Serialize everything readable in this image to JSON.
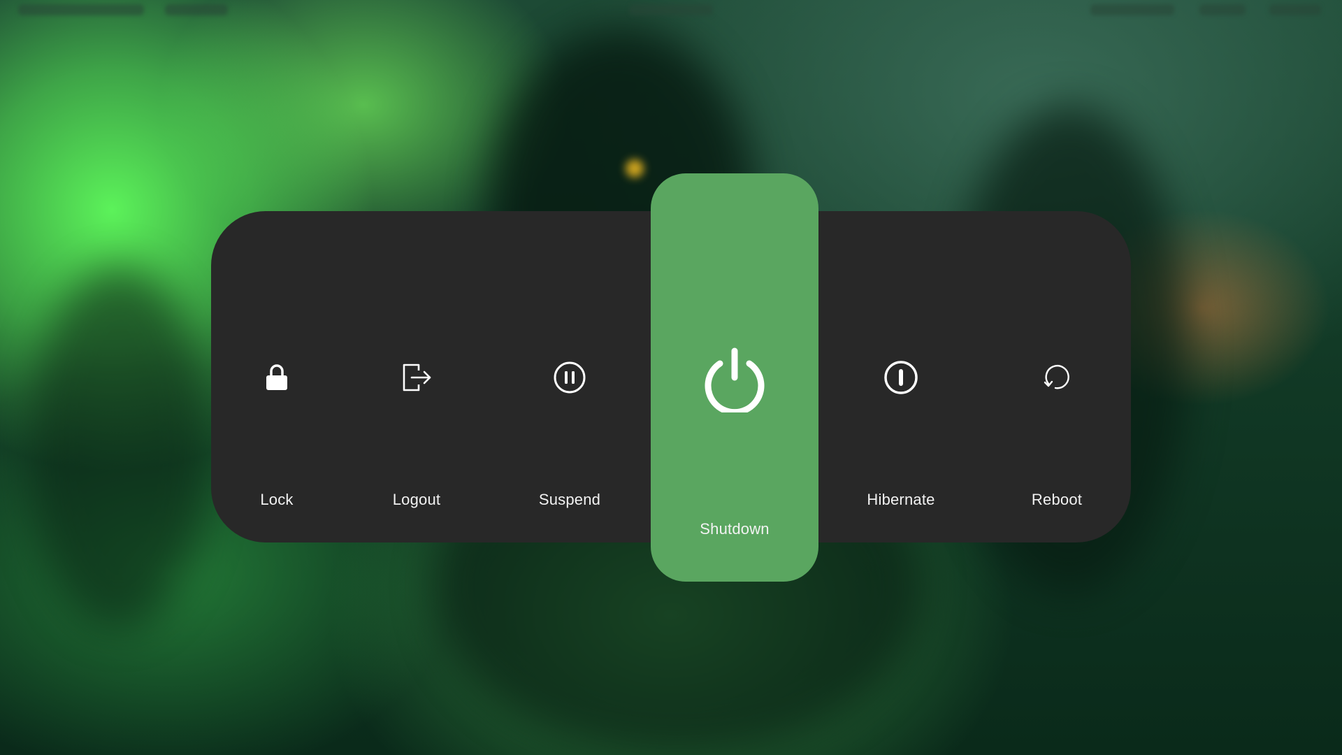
{
  "colors": {
    "panel_background": "#282828",
    "active_background": "#5aa660",
    "text": "#f2f2f2"
  },
  "power_menu": {
    "selected": "Shutdown",
    "options": [
      {
        "label": "Lock",
        "icon": "lock-icon"
      },
      {
        "label": "Logout",
        "icon": "logout-icon"
      },
      {
        "label": "Suspend",
        "icon": "pause-circle-icon"
      },
      {
        "label": "Shutdown",
        "icon": "power-icon"
      },
      {
        "label": "Hibernate",
        "icon": "hibernate-icon"
      },
      {
        "label": "Reboot",
        "icon": "reboot-icon"
      }
    ]
  }
}
